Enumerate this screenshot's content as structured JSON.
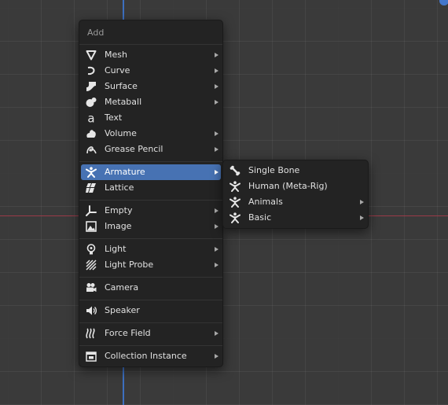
{
  "menu": {
    "title": "Add",
    "items": [
      {
        "label": "Mesh",
        "icon": "mesh-icon",
        "submenu": true
      },
      {
        "label": "Curve",
        "icon": "curve-icon",
        "submenu": true
      },
      {
        "label": "Surface",
        "icon": "surface-icon",
        "submenu": true
      },
      {
        "label": "Metaball",
        "icon": "metaball-icon",
        "submenu": true
      },
      {
        "label": "Text",
        "icon": "text-icon",
        "submenu": false
      },
      {
        "label": "Volume",
        "icon": "volume-icon",
        "submenu": true
      },
      {
        "label": "Grease Pencil",
        "icon": "grease-pencil-icon",
        "submenu": true
      },
      {
        "label": "Armature",
        "icon": "armature-icon",
        "submenu": true,
        "active": true
      },
      {
        "label": "Lattice",
        "icon": "lattice-icon",
        "submenu": false
      },
      {
        "label": "Empty",
        "icon": "empty-icon",
        "submenu": true
      },
      {
        "label": "Image",
        "icon": "image-icon",
        "submenu": true
      },
      {
        "label": "Light",
        "icon": "light-icon",
        "submenu": true
      },
      {
        "label": "Light Probe",
        "icon": "light-probe-icon",
        "submenu": true
      },
      {
        "label": "Camera",
        "icon": "camera-icon",
        "submenu": false
      },
      {
        "label": "Speaker",
        "icon": "speaker-icon",
        "submenu": false
      },
      {
        "label": "Force Field",
        "icon": "force-field-icon",
        "submenu": true
      },
      {
        "label": "Collection Instance",
        "icon": "collection-instance-icon",
        "submenu": true
      }
    ]
  },
  "submenu": {
    "items": [
      {
        "label": "Single Bone",
        "icon": "bone-icon",
        "submenu": false
      },
      {
        "label": "Human (Meta-Rig)",
        "icon": "armature-icon",
        "submenu": false
      },
      {
        "label": "Animals",
        "icon": "armature-icon",
        "submenu": true
      },
      {
        "label": "Basic",
        "icon": "armature-icon",
        "submenu": true
      }
    ]
  },
  "colors": {
    "background": "#3a3a3a",
    "menu_bg": "#232323",
    "highlight": "#4772b3",
    "axis_y": "#3d6fbf",
    "axis_x": "#9b3a48"
  }
}
